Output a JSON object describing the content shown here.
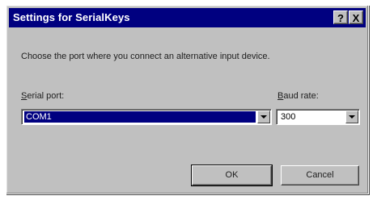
{
  "dialog": {
    "title": "Settings for SerialKeys",
    "help_button": "?",
    "close_button": "X",
    "instruction": "Choose the port where you connect an alternative input device.",
    "serial_port": {
      "label_mnemonic": "S",
      "label_rest": "erial port:",
      "value": "COM1",
      "dropdown_icon": "chevron-down-icon"
    },
    "baud_rate": {
      "label_mnemonic": "B",
      "label_rest": "aud rate:",
      "value": "300",
      "dropdown_icon": "chevron-down-icon"
    },
    "ok_label": "OK",
    "cancel_label": "Cancel"
  },
  "colors": {
    "titlebar": "#000080",
    "face": "#c0c0c0",
    "selection": "#000080"
  }
}
